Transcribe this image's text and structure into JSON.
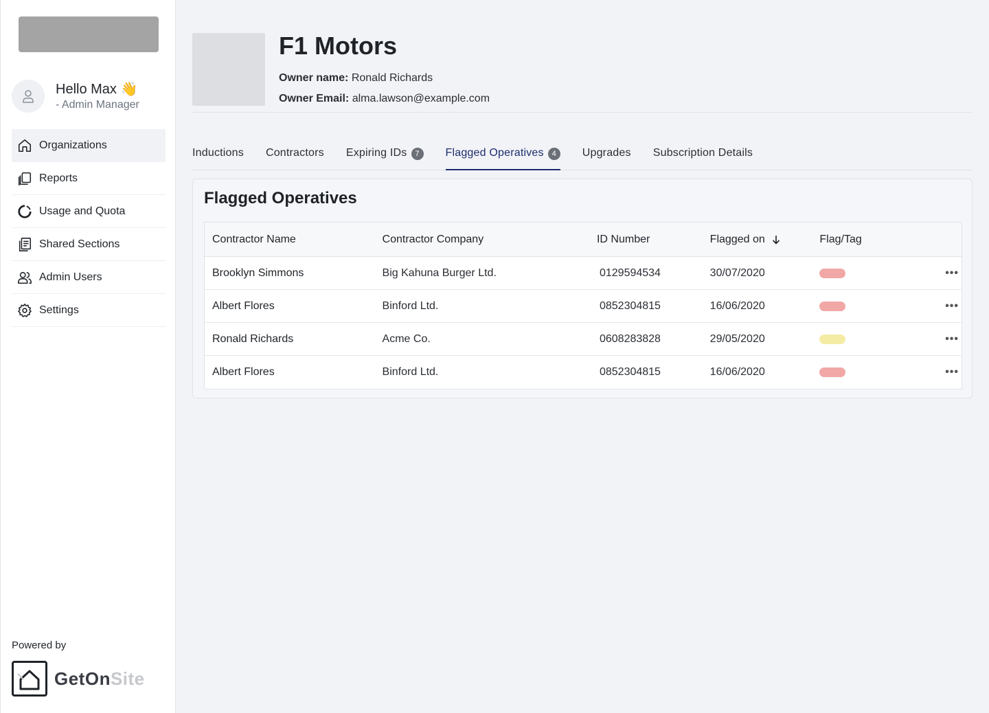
{
  "user": {
    "greeting": "Hello Max 👋",
    "role": "- Admin Manager"
  },
  "sidebar": {
    "items": [
      {
        "label": "Organizations",
        "icon": "home-icon"
      },
      {
        "label": "Reports",
        "icon": "documents-icon"
      },
      {
        "label": "Usage and Quota",
        "icon": "pie-chart-icon"
      },
      {
        "label": "Shared Sections",
        "icon": "shared-docs-icon"
      },
      {
        "label": "Admin Users",
        "icon": "users-icon"
      },
      {
        "label": "Settings",
        "icon": "gear-icon"
      }
    ],
    "active_index": 0
  },
  "footer": {
    "powered_by": "Powered by",
    "brand_dark": "GetOn",
    "brand_light": "Site"
  },
  "organization": {
    "name": "F1 Motors",
    "owner_name_label": "Owner name:",
    "owner_name": "Ronald Richards",
    "owner_email_label": "Owner Email:",
    "owner_email": "alma.lawson@example.com"
  },
  "tabs": [
    {
      "label": "Inductions"
    },
    {
      "label": "Contractors"
    },
    {
      "label": "Expiring IDs",
      "badge": "7"
    },
    {
      "label": "Flagged Operatives",
      "badge": "4",
      "active": true
    },
    {
      "label": "Upgrades"
    },
    {
      "label": "Subscription Details"
    }
  ],
  "flagged": {
    "title": "Flagged Operatives",
    "columns": [
      "Contractor Name",
      "Contractor Company",
      "ID Number",
      "Flagged on",
      "Flag/Tag"
    ],
    "sort_icon": "arrow-down-icon",
    "rows": [
      {
        "name": "Brooklyn Simmons",
        "company": "Big Kahuna Burger Ltd.",
        "id": "0129594534",
        "date": "30/07/2020",
        "flag_color": "#f2a7a7"
      },
      {
        "name": "Albert Flores",
        "company": "Binford Ltd.",
        "id": "0852304815",
        "date": "16/06/2020",
        "flag_color": "#f2a7a7"
      },
      {
        "name": "Ronald Richards",
        "company": "Acme Co.",
        "id": "0608283828",
        "date": "29/05/2020",
        "flag_color": "#f4eca4"
      },
      {
        "name": "Albert Flores",
        "company": "Binford Ltd.",
        "id": "0852304815",
        "date": "16/06/2020",
        "flag_color": "#f2a7a7"
      }
    ],
    "row_action_label": "•••"
  }
}
